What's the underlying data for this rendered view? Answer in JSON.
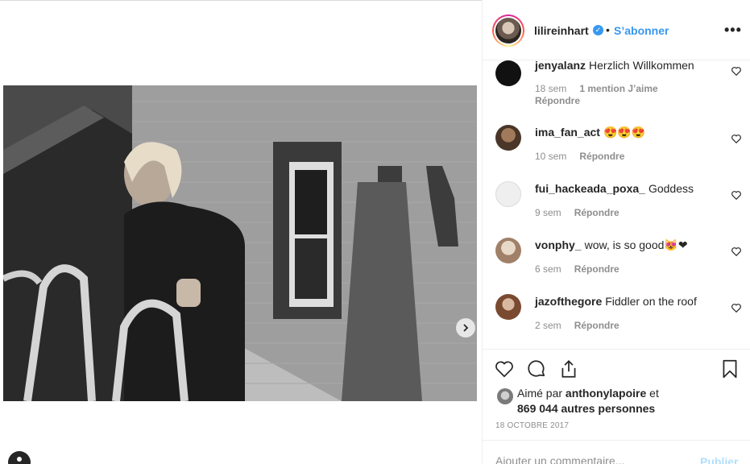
{
  "post": {
    "username": "lilireinhart",
    "separator": "•",
    "follow_label": "S’abonner",
    "more_label": "•••",
    "verified_glyph": "✓"
  },
  "comments": [
    {
      "user": "jenyalanz",
      "text": "Herzlich Willkommen",
      "time": "18 sem",
      "likes": "1 mention J’aime",
      "reply": "Répondre",
      "avatar_color": "#111111"
    },
    {
      "user": "ima_fan_act",
      "text": "😍😍😍",
      "time": "10 sem",
      "reply": "Répondre",
      "avatar_color": "#6b4f3a"
    },
    {
      "user": "fui_hackeada_poxa_",
      "text": "Goddess",
      "time": "9 sem",
      "reply": "Répondre",
      "avatar_color": "#e0e0e0"
    },
    {
      "user": "vonphy_",
      "text": "wow, is so good😻❤",
      "time": "6 sem",
      "reply": "Répondre",
      "avatar_color": "#c9a98a"
    },
    {
      "user": "jazofthegore",
      "text": "Fiddler on the roof",
      "time": "2 sem",
      "reply": "Répondre",
      "avatar_color": "#8a5a3c"
    }
  ],
  "likes": {
    "prefix": "Aimé par ",
    "first_user": "anthonylapoire",
    "middle": " et",
    "count_text": "869 044 autres personnes"
  },
  "date": "18 OCTOBRE 2017",
  "add_comment": {
    "placeholder": "Ajouter un commentaire...",
    "publish_label": "Publier"
  },
  "icons": {
    "like": "heart-icon",
    "comment": "comment-icon",
    "share": "share-icon",
    "save": "bookmark-icon",
    "next": "chevron-right-icon"
  }
}
